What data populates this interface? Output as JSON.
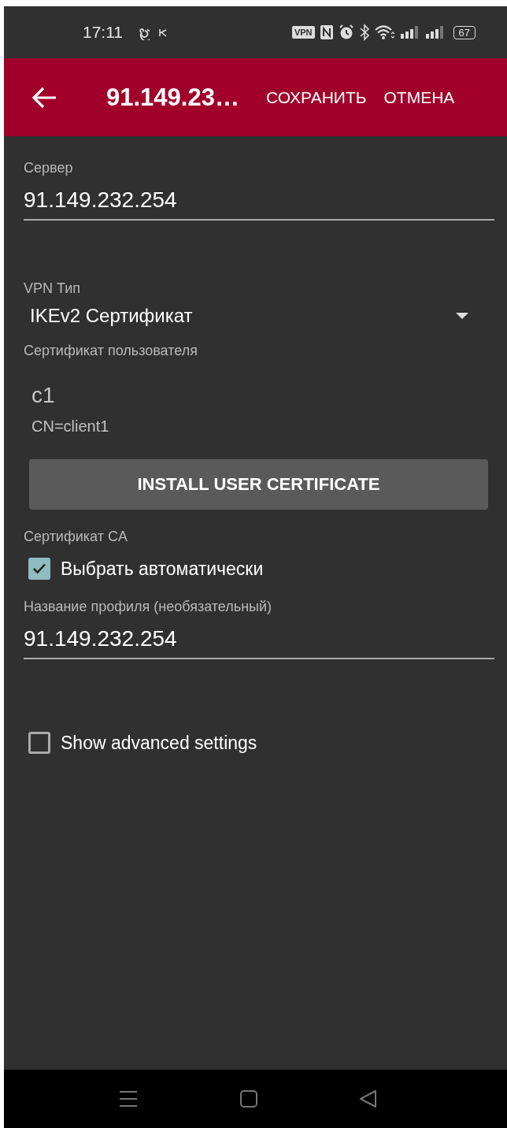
{
  "status_bar": {
    "time": "17:11",
    "vpn_badge": "VPN",
    "battery": "67"
  },
  "app_bar": {
    "title": "91.149.23…",
    "actions": [
      "СОХРАНИТЬ",
      "ОТМЕНА"
    ]
  },
  "form": {
    "server": {
      "label": "Сервер",
      "value": "91.149.232.254"
    },
    "vpn_type": {
      "label": "VPN Тип",
      "value": "IKEv2 Сертификат"
    },
    "user_certificate": {
      "label": "Сертификат пользователя",
      "name": "c1",
      "subject": "CN=client1",
      "install_button": "INSTALL USER CERTIFICATE"
    },
    "ca_certificate": {
      "label": "Сертификат CA",
      "auto_select": {
        "label": "Выбрать автоматически",
        "checked": true
      }
    },
    "profile_name": {
      "label": "Название профиля (необязательный)",
      "value": "91.149.232.254"
    },
    "advanced": {
      "label": "Show advanced settings",
      "checked": false
    }
  }
}
